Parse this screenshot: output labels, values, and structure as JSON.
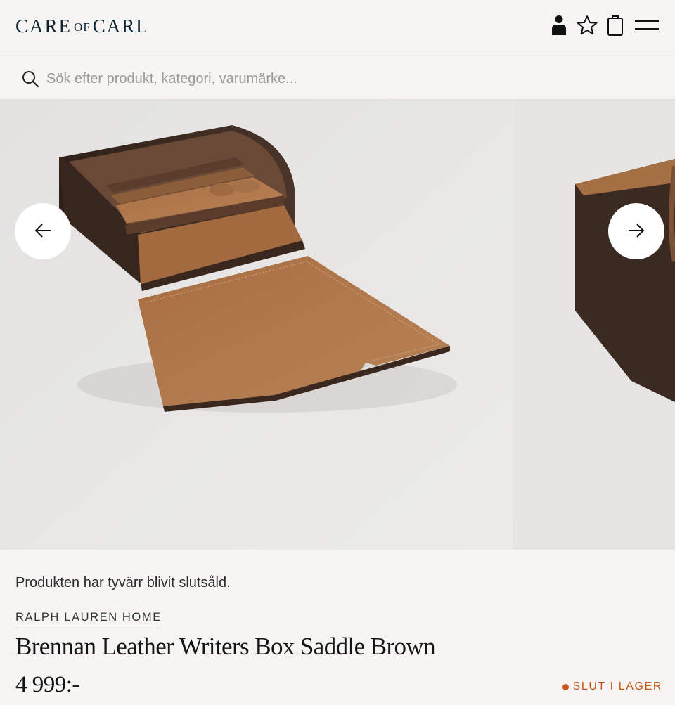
{
  "header": {
    "logo_main_left": "CARE",
    "logo_of": "OF",
    "logo_main_right": "CARL",
    "icons": [
      "account-icon",
      "favorites-star-icon",
      "shopping-bag-icon",
      "menu-hamburger-icon"
    ]
  },
  "search": {
    "placeholder": "Sök efter produkt, kategori, varumärke..."
  },
  "gallery": {
    "icons": [
      "arrow-left-icon",
      "arrow-right-icon"
    ]
  },
  "product": {
    "sold_out_message": "Produkten har tyvärr blivit slutsåld.",
    "brand": "RALPH LAUREN HOME",
    "title": "Brennan Leather Writers Box Saddle Brown",
    "price": "4 999:-",
    "stock_status": "SLUT I LAGER"
  },
  "colors": {
    "brand_navy": "#0f2333",
    "background": "#f6f5f3",
    "stock_orange": "#c8531a",
    "leather": "#b07a4c",
    "wood": "#3b2a20"
  }
}
